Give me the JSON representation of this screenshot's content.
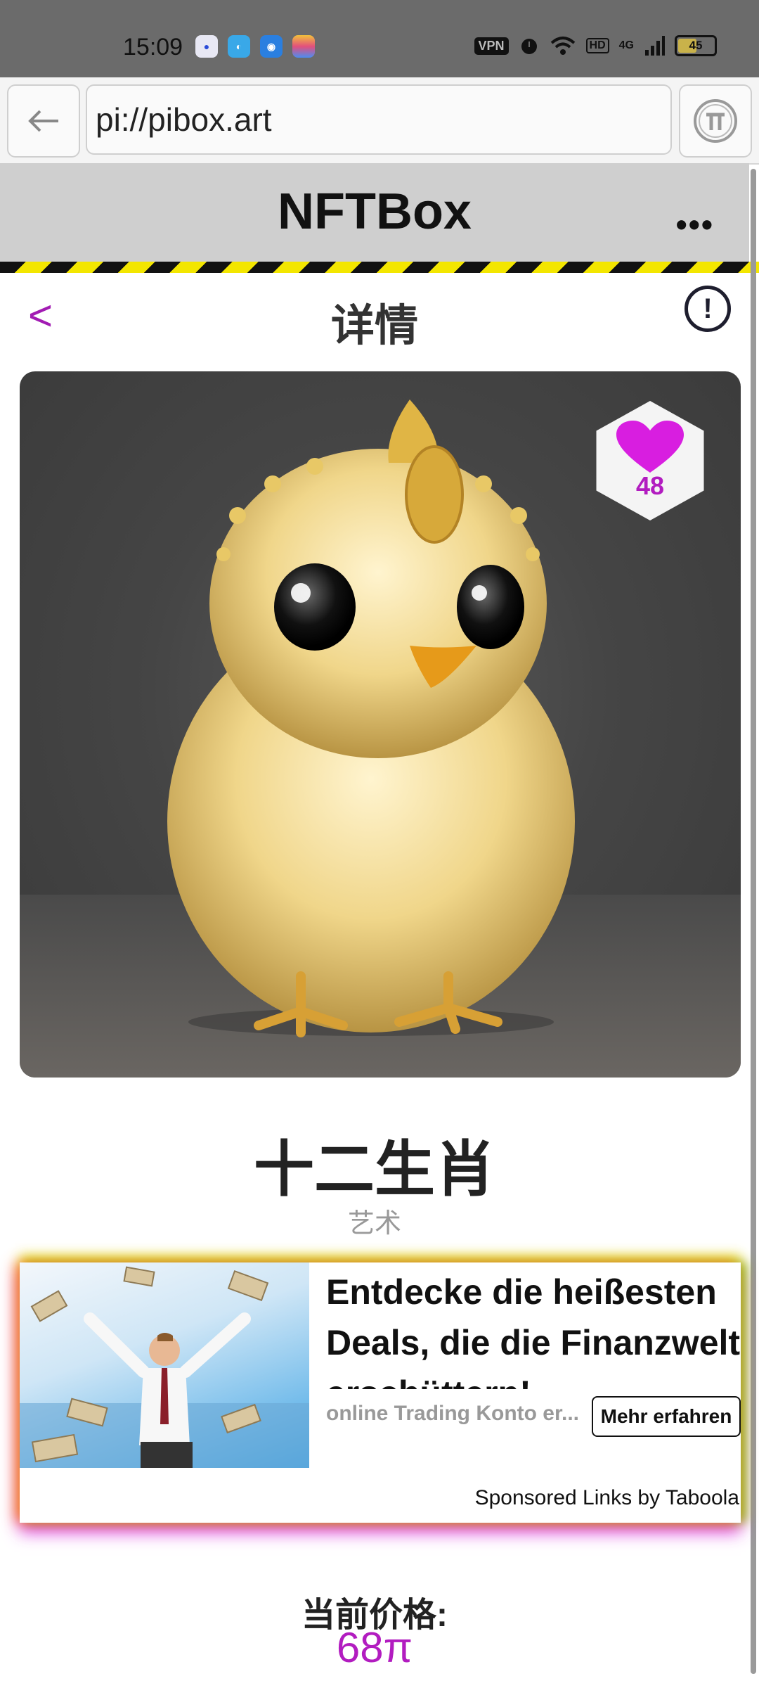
{
  "status_bar": {
    "time": "15:09",
    "vpn_label": "VPN",
    "hd_label": "HD",
    "network_label": "4G",
    "battery_level": "45"
  },
  "browser": {
    "url": "pi://pibox.art",
    "back_icon": "arrow-left-icon",
    "pi_icon": "pi-logo-icon"
  },
  "app_header": {
    "title": "NFTBox",
    "menu_label": "•••"
  },
  "page": {
    "title": "详情",
    "back_label": "<",
    "info_label": "!"
  },
  "nft": {
    "likes": "48",
    "name": "十二生肖",
    "category": "艺术",
    "price_label": "当前价格:",
    "price": "68π"
  },
  "ad": {
    "headline": "Entdecke die heißesten Deals, die die Finanzwelt erschüttern!",
    "source": "online Trading Konto er...",
    "cta": "Mehr erfahren",
    "credit": "Sponsored Links by Taboola"
  },
  "colors": {
    "accent": "#b21cc0",
    "heart": "#d81ee0",
    "header_bg": "#cfcfcf",
    "hazard_yellow": "#f3e600"
  }
}
